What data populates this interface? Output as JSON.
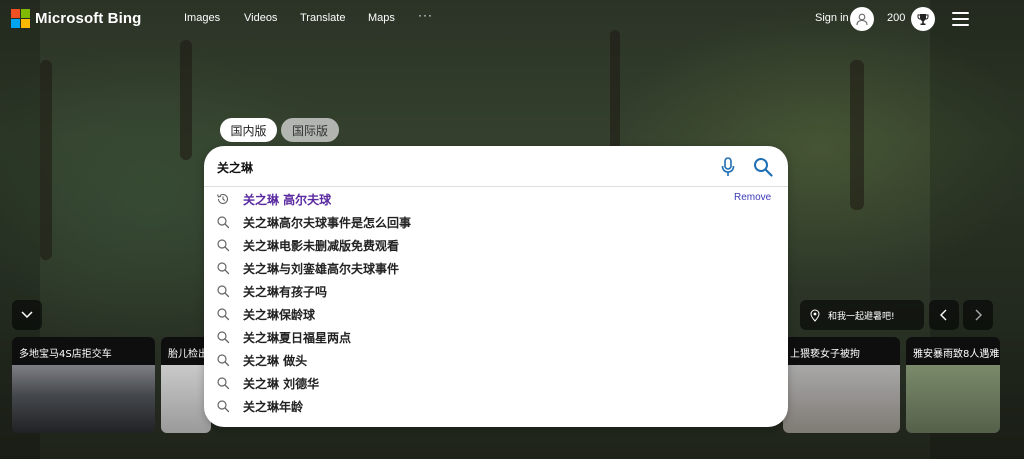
{
  "brand": {
    "name": "Microsoft Bing",
    "logo_colors": [
      "#f25022",
      "#7fba00",
      "#00a4ef",
      "#ffb900"
    ]
  },
  "nav": {
    "items": [
      "Images",
      "Videos",
      "Translate",
      "Maps"
    ],
    "more": "···"
  },
  "account": {
    "sign_in": "Sign in",
    "points": "200"
  },
  "scopes": {
    "domestic": "国内版",
    "international": "国际版",
    "selected": "国内版"
  },
  "search": {
    "query": "关之琳",
    "suggestions": [
      {
        "text": "关之琳 高尔夫球",
        "type": "history",
        "icon": "history-icon"
      },
      {
        "text": "关之琳高尔夫球事件是怎么回事",
        "type": "search",
        "icon": "search-icon"
      },
      {
        "text": "关之琳电影未删减版免费观看",
        "type": "search",
        "icon": "search-icon"
      },
      {
        "text": "关之琳与刘銮雄高尔夫球事件",
        "type": "search",
        "icon": "search-icon"
      },
      {
        "text": "关之琳有孩子吗",
        "type": "search",
        "icon": "search-icon"
      },
      {
        "text": "关之琳保龄球",
        "type": "search",
        "icon": "search-icon"
      },
      {
        "text": "关之琳夏日福星两点",
        "type": "search",
        "icon": "search-icon"
      },
      {
        "text": "关之琳 做头",
        "type": "search",
        "icon": "search-icon"
      },
      {
        "text": "关之琳 刘德华",
        "type": "search",
        "icon": "search-icon"
      },
      {
        "text": "关之琳年龄",
        "type": "search",
        "icon": "search-icon"
      }
    ],
    "remove_label": "Remove"
  },
  "location": {
    "text": "和我一起避暑吧!"
  },
  "news_cards": [
    {
      "title": "多地宝马4S店拒交车"
    },
    {
      "title": "胎儿检出"
    },
    {
      "title": "上猥亵女子被拘"
    },
    {
      "title": "雅安暴雨致8人遇难"
    }
  ],
  "colors": {
    "history_text": "#5a2aa0",
    "remove_link": "#3b3bb8",
    "icon_blue": "#1e6fb4"
  }
}
